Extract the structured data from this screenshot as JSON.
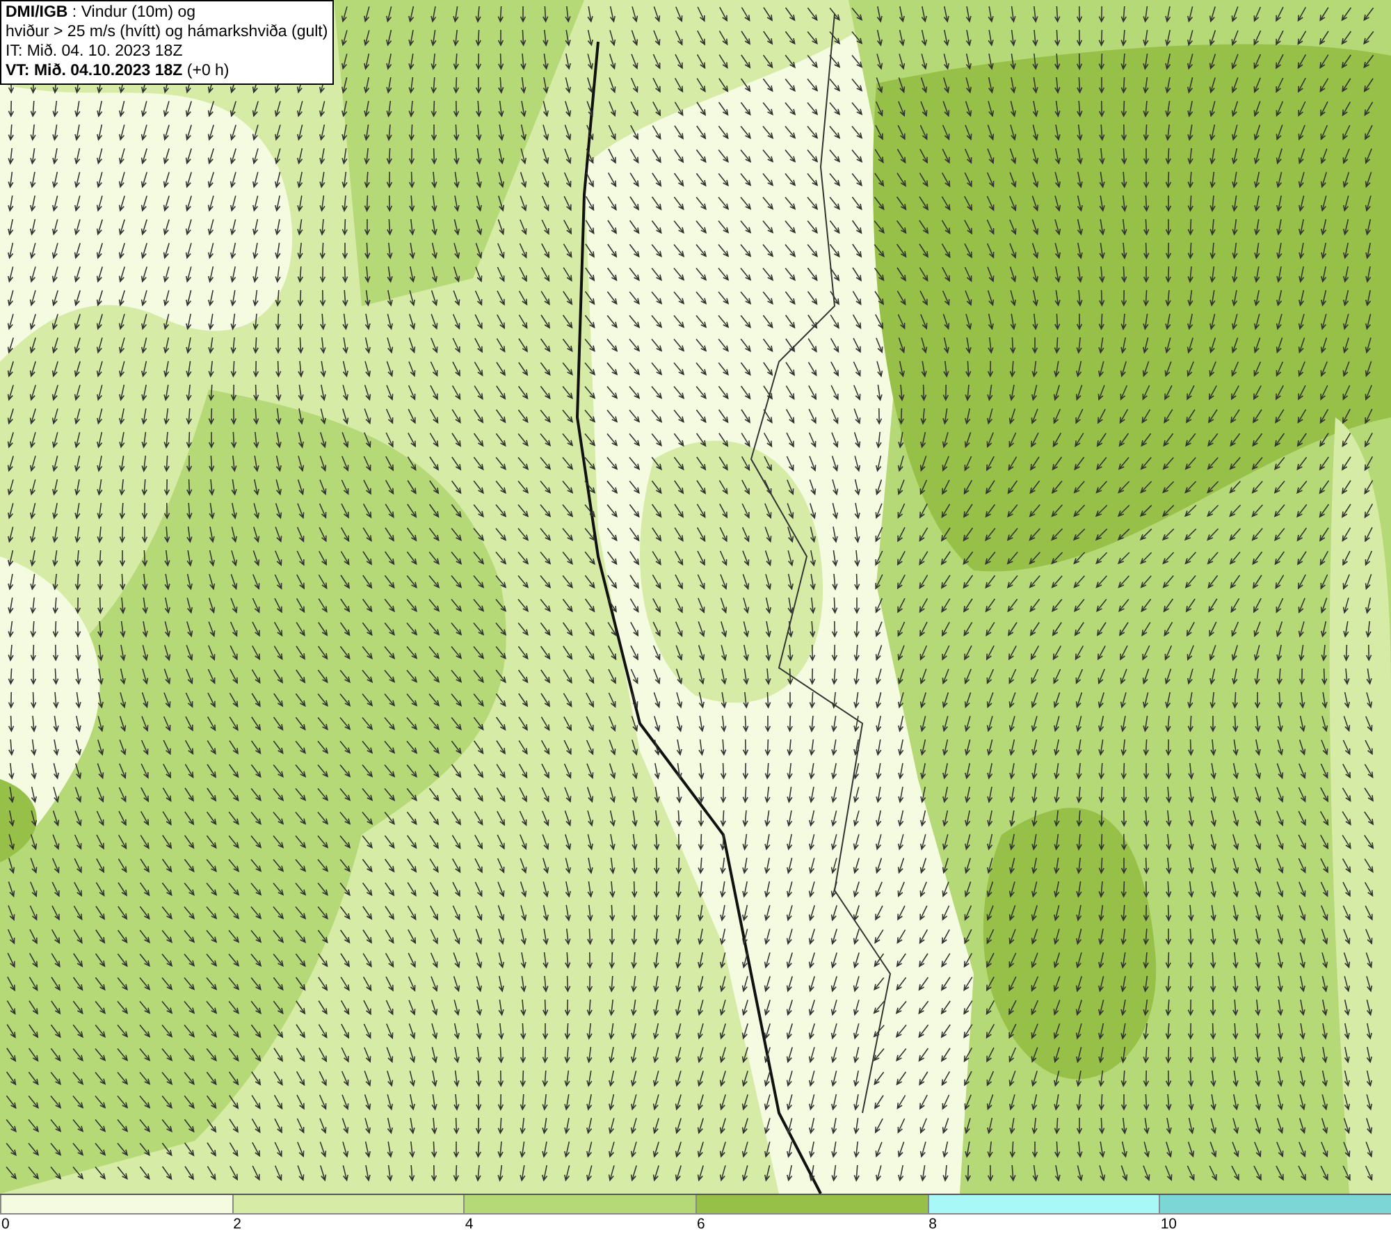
{
  "legend_box": {
    "lines": [
      "**DMI/IGB** : Vindur (10m) og",
      "hviður > 25 m/s (hvítt) og hámarkshviða (gult)",
      "IT: Mið. 04. 10. 2023 18Z",
      "**VT: Mið. 04.10.2023 18Z** (+0 h)"
    ]
  },
  "color_scale": {
    "bins": [
      {
        "color": "#f4fbe0",
        "label": "0"
      },
      {
        "color": "#d6eca6",
        "label": "2"
      },
      {
        "color": "#b6d978",
        "label": "4"
      },
      {
        "color": "#97c048",
        "label": "6"
      },
      {
        "color": "#a8f8f8",
        "label": "8"
      },
      {
        "color": "#7dd6d6",
        "label": "10"
      }
    ]
  }
}
